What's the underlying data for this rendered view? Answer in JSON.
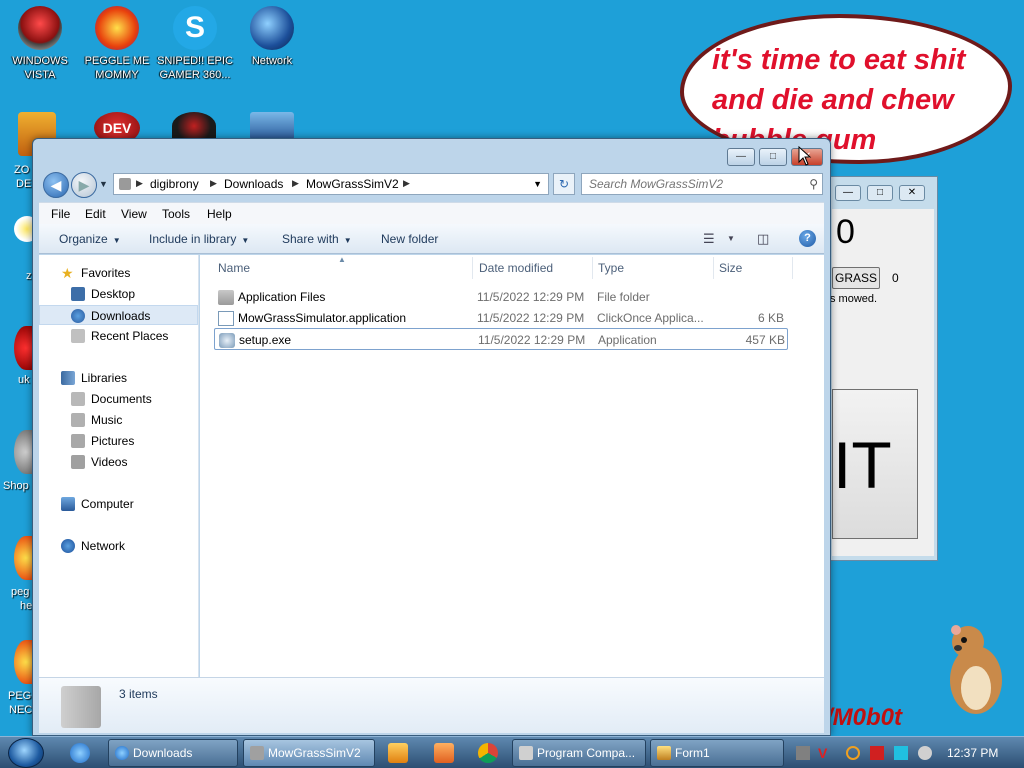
{
  "desktop": {
    "icons": [
      {
        "label": "WINDOWS VISTA"
      },
      {
        "label": "PEGGLE ME MOMMY"
      },
      {
        "label": "SNIPED!! EPIC GAMER 360..."
      },
      {
        "label": "Network"
      },
      {
        "label": "DEV"
      }
    ],
    "partial_labels": [
      "ZO",
      "DE",
      "uk",
      "Shop",
      "peg",
      "he",
      "PEGG",
      "NEC",
      "z"
    ],
    "bubble_text": "it's time to eat shit and die and chew bubble gum",
    "watermark": "/M0b0t"
  },
  "explorer": {
    "address": {
      "crumbs": [
        "digibrony",
        "Downloads",
        "MowGrassSimV2"
      ]
    },
    "search": {
      "placeholder": "Search MowGrassSimV2"
    },
    "menu": [
      "File",
      "Edit",
      "View",
      "Tools",
      "Help"
    ],
    "toolbar": {
      "organize": "Organize",
      "include_in_library": "Include in library",
      "share_with": "Share with",
      "new_folder": "New folder"
    },
    "nav": {
      "favorites": "Favorites",
      "desktop": "Desktop",
      "downloads": "Downloads",
      "recent_places": "Recent Places",
      "libraries": "Libraries",
      "documents": "Documents",
      "music": "Music",
      "pictures": "Pictures",
      "videos": "Videos",
      "computer": "Computer",
      "network": "Network"
    },
    "columns": {
      "name": "Name",
      "date_modified": "Date modified",
      "type": "Type",
      "size": "Size"
    },
    "files": [
      {
        "name": "Application Files",
        "date": "11/5/2022 12:29 PM",
        "type": "File folder",
        "size": ""
      },
      {
        "name": "MowGrassSimulator.application",
        "date": "11/5/2022 12:29 PM",
        "type": "ClickOnce Applica...",
        "size": "6 KB"
      },
      {
        "name": "setup.exe",
        "date": "11/5/2022 12:29 PM",
        "type": "Application",
        "size": "457 KB"
      }
    ],
    "status": {
      "count": "3 items"
    }
  },
  "form1": {
    "big_number": "0",
    "grass_button": "GRASS",
    "count": "0",
    "mowed_text": "s mowed.",
    "exit_button": "IT"
  },
  "taskbar": {
    "tasks": [
      "Downloads",
      "MowGrassSimV2",
      "Program Compa...",
      "Form1"
    ],
    "clock": "12:37 PM"
  },
  "colors": {
    "desktop_bg": "#1ea0d8",
    "bubble_text": "#e0102c",
    "selection": "#dde9f6"
  }
}
